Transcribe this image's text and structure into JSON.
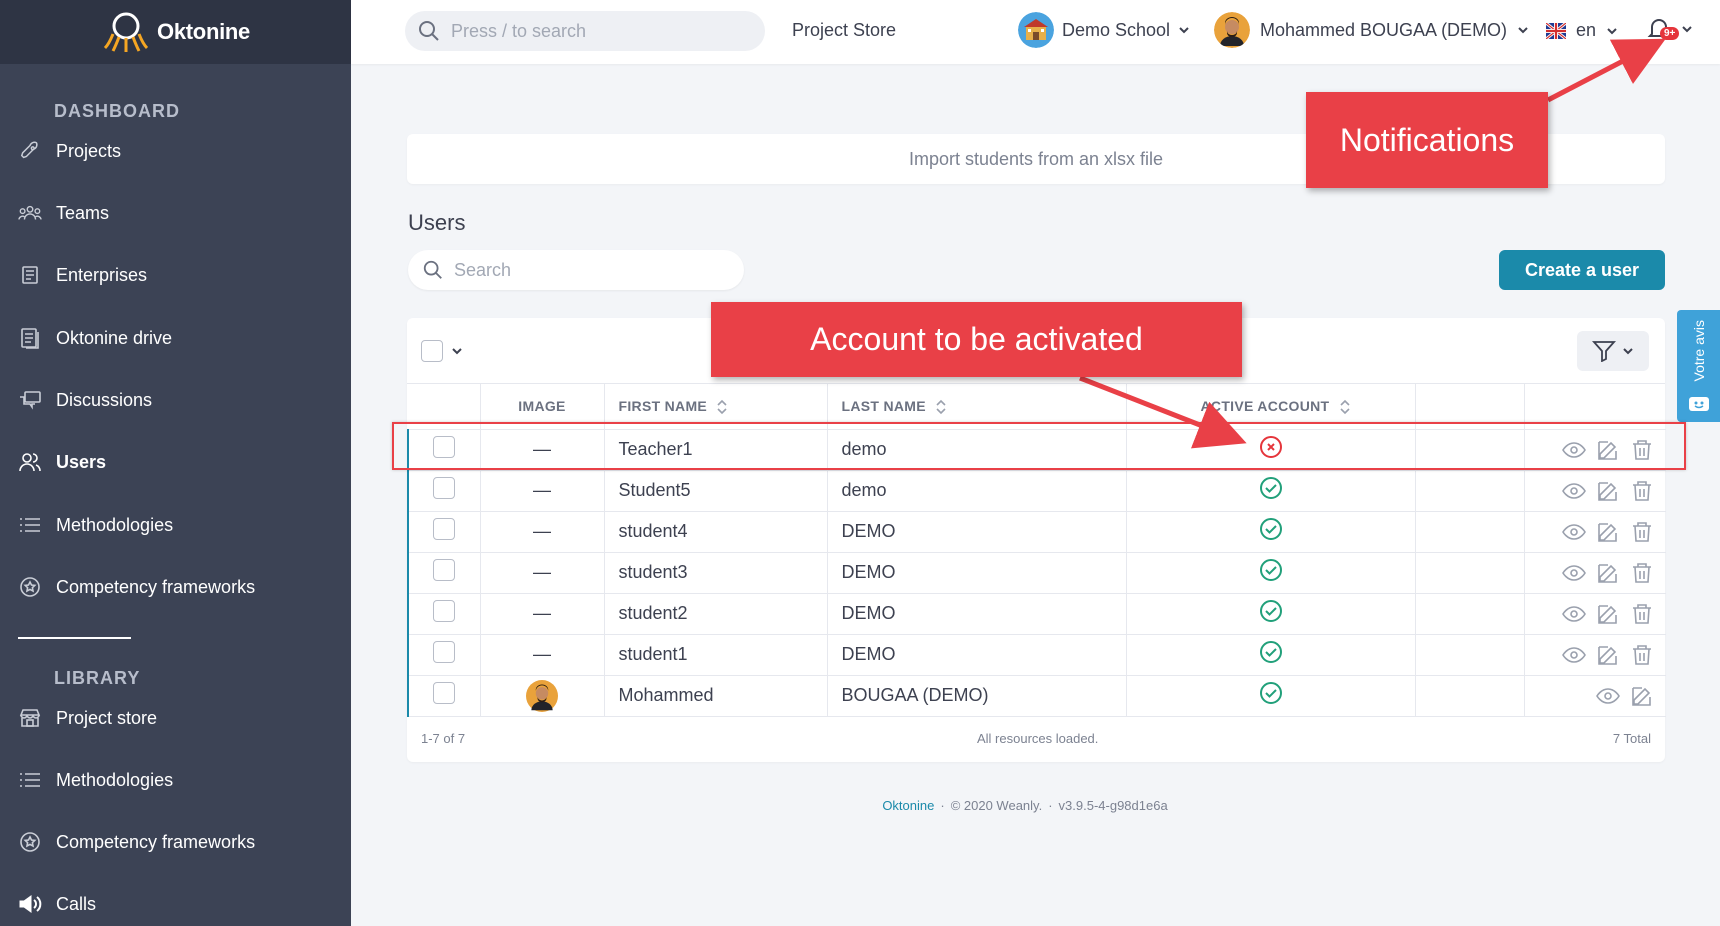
{
  "brand": {
    "name": "Oktonine"
  },
  "topbar": {
    "search_placeholder": "Press / to search",
    "project_store": "Project Store",
    "school": "Demo School",
    "user": "Mohammed BOUGAA (DEMO)",
    "language": "en",
    "notifications_badge": "9+"
  },
  "sidebar": {
    "dashboard_heading": "DASHBOARD",
    "dashboard_items": [
      {
        "label": "Projects",
        "icon": "rocket-icon"
      },
      {
        "label": "Teams",
        "icon": "teams-icon"
      },
      {
        "label": "Enterprises",
        "icon": "enterprise-icon"
      },
      {
        "label": "Oktonine drive",
        "icon": "drive-icon"
      },
      {
        "label": "Discussions",
        "icon": "discussions-icon"
      },
      {
        "label": "Users",
        "icon": "users-icon",
        "active": true
      },
      {
        "label": "Methodologies",
        "icon": "list-icon"
      },
      {
        "label": "Competency frameworks",
        "icon": "badge-icon"
      }
    ],
    "library_heading": "LIBRARY",
    "library_items": [
      {
        "label": "Project store",
        "icon": "store-icon"
      },
      {
        "label": "Methodologies",
        "icon": "list-icon"
      },
      {
        "label": "Competency frameworks",
        "icon": "badge-icon"
      },
      {
        "label": "Calls",
        "icon": "megaphone-icon"
      }
    ]
  },
  "main": {
    "import_label": "Import students from an xlsx file",
    "users_title": "Users",
    "search_placeholder": "Search",
    "create_button": "Create a user"
  },
  "table": {
    "columns": [
      "IMAGE",
      "FIRST NAME",
      "LAST NAME",
      "ACTIVE ACCOUNT"
    ],
    "rows": [
      {
        "image": "—",
        "first_name": "Teacher1",
        "last_name": "demo",
        "active": false
      },
      {
        "image": "—",
        "first_name": "Student5",
        "last_name": "demo",
        "active": true
      },
      {
        "image": "—",
        "first_name": "student4",
        "last_name": "DEMO",
        "active": true
      },
      {
        "image": "—",
        "first_name": "student3",
        "last_name": "DEMO",
        "active": true
      },
      {
        "image": "—",
        "first_name": "student2",
        "last_name": "DEMO",
        "active": true
      },
      {
        "image": "—",
        "first_name": "student1",
        "last_name": "DEMO",
        "active": true
      },
      {
        "image": "avatar",
        "first_name": "Mohammed",
        "last_name": "BOUGAA (DEMO)",
        "active": true
      }
    ],
    "range": "1-7 of 7",
    "status": "All resources loaded.",
    "total": "7 Total"
  },
  "footer": {
    "brand_link": "Oktonine",
    "separator": "·",
    "copyright": "© 2020 Weanly.",
    "version": "v3.9.5-4-g98d1e6a"
  },
  "feedback": {
    "label": "Votre avis"
  },
  "annotations": {
    "notifications": "Notifications",
    "account": "Account to be activated"
  },
  "colors": {
    "sidebar": "#3c4355",
    "accent": "#1b8aaa",
    "annotation": "#e94047",
    "active_ok": "#21a07a",
    "inactive": "#e5353b"
  }
}
